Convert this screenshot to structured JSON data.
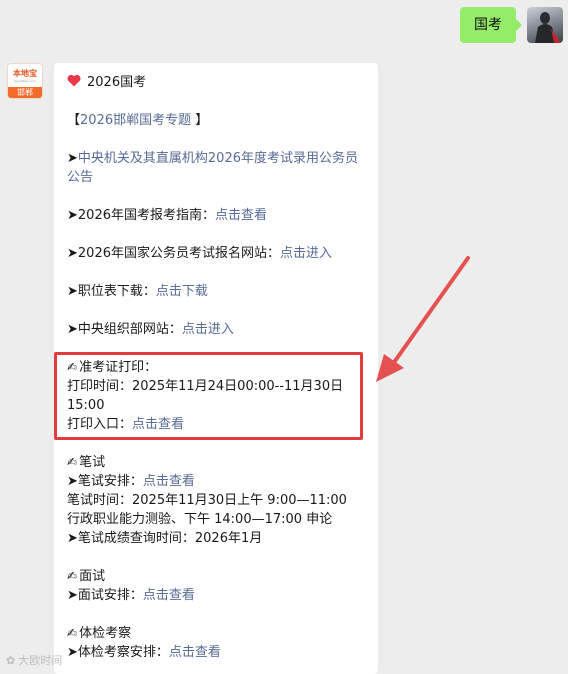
{
  "sent": {
    "text": "国考"
  },
  "bot": {
    "logo_text": "本地宝",
    "logo_sub": "bendibao.com",
    "city": "邯郸"
  },
  "message": {
    "title": "2026国考",
    "topic": {
      "open": "【",
      "text": "2026邯郸国考专题",
      "close": " 】"
    },
    "items": [
      {
        "arrow": "➤",
        "link": "中央机关及其直属机构2026年度考试录用公务员公告"
      },
      {
        "arrow": "➤",
        "label": "2026年国考报考指南：",
        "link": "点击查看"
      },
      {
        "arrow": "➤",
        "label": "2026年国家公务员考试报名网站：",
        "link": "点击进入"
      },
      {
        "arrow": "➤",
        "label": "职位表下载：",
        "link": "点击下载"
      },
      {
        "arrow": "➤",
        "label": "中央组织部网站：",
        "link": "点击进入"
      }
    ],
    "admission": {
      "heading": "准考证打印：",
      "time_line1": "打印时间：2025年11月24日00:00--11月30日",
      "time_line2": "15:00",
      "entry_label": "打印入口：",
      "entry_link": "点击查看"
    },
    "written": {
      "heading": "笔试",
      "arrange_label": "➤笔试安排：",
      "arrange_link": "点击查看",
      "time_line1": "笔试时间：2025年11月30日上午 9:00—11:00",
      "time_line2": "行政职业能力测验、下午 14:00—17:00 申论",
      "score_line": "➤笔试成绩查询时间：2026年1月"
    },
    "interview": {
      "heading": "面试",
      "arrange_label": "➤面试安排：",
      "arrange_link": "点击查看"
    },
    "physical": {
      "heading": "体检考察",
      "arrange_label": "➤体检考察安排：",
      "arrange_link": "点击查看"
    }
  },
  "watermark": "大欧时间",
  "colors": {
    "sent_bubble": "#95ec69",
    "link": "#576b95",
    "highlight": "#e23c3c",
    "heart": "#e8384a"
  }
}
